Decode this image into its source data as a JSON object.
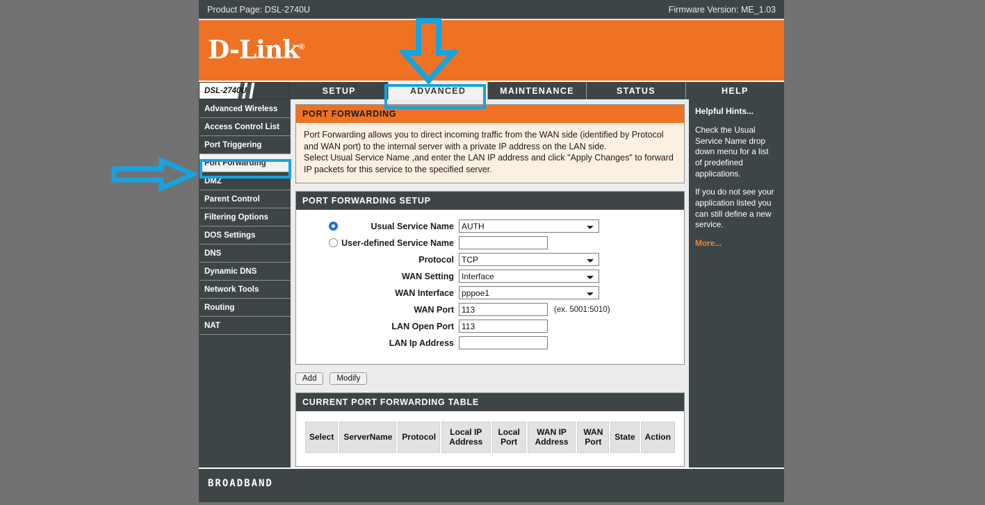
{
  "topbar": {
    "product_page_label": "Product Page: DSL-2740U",
    "firmware_label": "Firmware Version: ME_1.03"
  },
  "banner": {
    "logo_text": "D-Link",
    "logo_mark": "®"
  },
  "nav": {
    "device_tab": "DSL-2740U",
    "tabs": [
      {
        "label": "SETUP",
        "active": false
      },
      {
        "label": "ADVANCED",
        "active": true
      },
      {
        "label": "MAINTENANCE",
        "active": false
      },
      {
        "label": "STATUS",
        "active": false
      },
      {
        "label": "HELP",
        "active": false
      }
    ]
  },
  "sidebar": {
    "items": [
      {
        "label": "Advanced Wireless",
        "active": false
      },
      {
        "label": "Access Control List",
        "active": false
      },
      {
        "label": "Port Triggering",
        "active": false
      },
      {
        "label": "Port Forwarding",
        "active": true
      },
      {
        "label": "DMZ",
        "active": false
      },
      {
        "label": "Parent Control",
        "active": false
      },
      {
        "label": "Filtering Options",
        "active": false
      },
      {
        "label": "DOS Settings",
        "active": false
      },
      {
        "label": "DNS",
        "active": false
      },
      {
        "label": "Dynamic DNS",
        "active": false
      },
      {
        "label": "Network Tools",
        "active": false
      },
      {
        "label": "Routing",
        "active": false
      },
      {
        "label": "NAT",
        "active": false
      }
    ]
  },
  "main": {
    "intro": {
      "title": "PORT FORWARDING",
      "line1": "Port Forwarding allows you to direct incoming traffic from the WAN side (identified by Protocol and WAN port) to the internal server with a private IP address on the LAN side.",
      "line2": "Select Usual Service Name ,and enter the LAN IP address and click \"Apply Changes\" to forward IP packets for this service to the specified server."
    },
    "setup": {
      "title": "PORT FORWARDING SETUP",
      "usual_service_name_label": "Usual Service Name",
      "usual_service_name_value": "AUTH",
      "user_defined_label": "User-defined Service Name",
      "user_defined_value": "",
      "user_defined_placeholder": "",
      "protocol_label": "Protocol",
      "protocol_value": "TCP",
      "wan_setting_label": "WAN Setting",
      "wan_setting_value": "Interface",
      "wan_interface_label": "WAN Interface",
      "wan_interface_value": "pppoe1",
      "wan_port_label": "WAN Port",
      "wan_port_value": "113",
      "wan_port_hint": "(ex. 5001:5010)",
      "lan_open_port_label": "LAN Open Port",
      "lan_open_port_value": "113",
      "lan_ip_label": "LAN Ip Address",
      "lan_ip_value": ""
    },
    "buttons": {
      "add": "Add",
      "modify": "Modify"
    },
    "table": {
      "title": "CURRENT PORT FORWARDING TABLE",
      "headers": [
        "Select",
        "ServerName",
        "Protocol",
        "Local IP Address",
        "Local Port",
        "WAN IP Address",
        "WAN Port",
        "State",
        "Action"
      ],
      "rows": []
    }
  },
  "hints": {
    "title": "Helpful Hints...",
    "p1": "Check the Usual Service Name drop down menu for a list of predefined applications.",
    "p2": "If you do not see your application listed you can still define a new service.",
    "more": "More..."
  },
  "footer": {
    "label": "BROADBAND"
  },
  "annotations": {
    "arrow_color": "#17a2e0",
    "down_arrow_target": "ADVANCED",
    "right_arrow_target": "Port Forwarding"
  },
  "colors": {
    "page_background": "#727272",
    "brand_orange": "#ef7224",
    "dark_slate": "#3e4547",
    "accent_cyan": "#17a2e0",
    "hint_link_orange": "#e8833a"
  }
}
